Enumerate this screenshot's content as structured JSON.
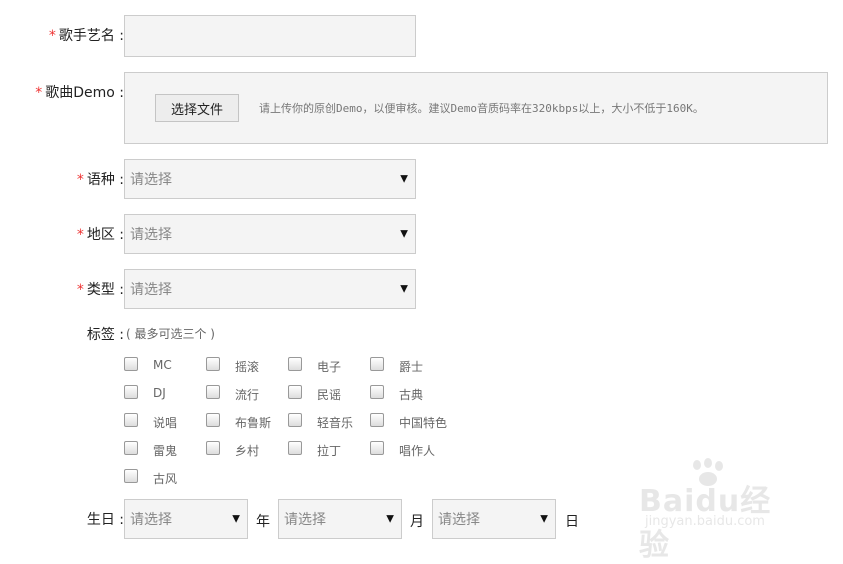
{
  "required_mark": "*",
  "singer": {
    "label": "歌手艺名 :"
  },
  "demo": {
    "label": "歌曲Demo :",
    "button": "选择文件",
    "hint": "请上传你的原创Demo，以便审核。建议Demo音质码率在320kbps以上，大小不低于160K。"
  },
  "language": {
    "label": "语种 :",
    "placeholder": "请选择"
  },
  "region": {
    "label": "地区 :",
    "placeholder": "请选择"
  },
  "genre": {
    "label": "类型 :",
    "placeholder": "请选择"
  },
  "tags": {
    "label": "标签 :",
    "hint": "( 最多可选三个 )",
    "items": [
      "MC",
      "摇滚",
      "电子",
      "爵士",
      "DJ",
      "流行",
      "民谣",
      "古典",
      "说唱",
      "布鲁斯",
      "轻音乐",
      "中国特色",
      "雷鬼",
      "乡村",
      "拉丁",
      "唱作人",
      "古风"
    ]
  },
  "birthday": {
    "label": "生日 :",
    "year_placeholder": "请选择",
    "month_placeholder": "请选择",
    "day_placeholder": "请选择",
    "year_unit": "年",
    "month_unit": "月",
    "day_unit": "日"
  },
  "watermark": {
    "brand": "Baidu经验",
    "url": "jingyan.baidu.com"
  },
  "icons": {
    "dropdown": "triangle-down-icon",
    "checkbox": "checkbox-unchecked-icon"
  }
}
